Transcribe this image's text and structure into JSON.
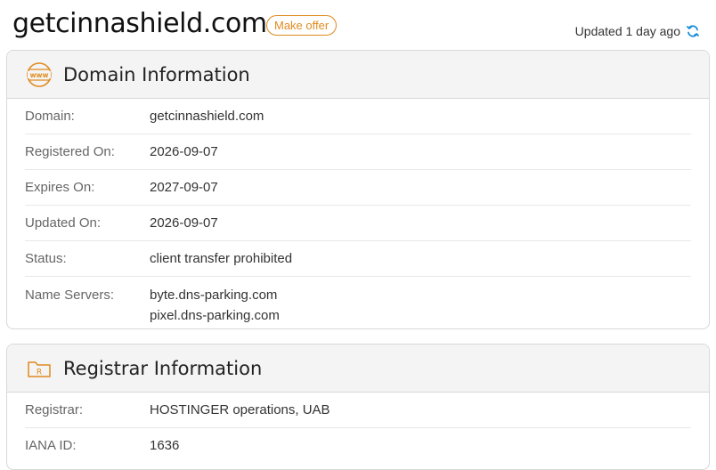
{
  "header": {
    "domain": "getcinnashield.com",
    "offer_label": "Make offer",
    "updated_text": "Updated 1 day ago",
    "accent_color": "#e08a1e",
    "refresh_color": "#1a8fd6"
  },
  "domain_info": {
    "title": "Domain Information",
    "icon": "www-globe-icon",
    "rows": [
      {
        "label": "Domain:",
        "value": "getcinnashield.com"
      },
      {
        "label": "Registered On:",
        "value": "2026-09-07"
      },
      {
        "label": "Expires On:",
        "value": "2027-09-07"
      },
      {
        "label": "Updated On:",
        "value": "2026-09-07"
      },
      {
        "label": "Status:",
        "value": "client transfer prohibited"
      }
    ],
    "name_servers": {
      "label": "Name Servers:",
      "values": [
        "byte.dns-parking.com",
        "pixel.dns-parking.com"
      ]
    }
  },
  "registrar_info": {
    "title": "Registrar Information",
    "icon": "registrar-folder-icon",
    "icon_letter": "R",
    "rows": [
      {
        "label": "Registrar:",
        "value": "HOSTINGER operations, UAB"
      },
      {
        "label": "IANA ID:",
        "value": "1636"
      }
    ]
  }
}
